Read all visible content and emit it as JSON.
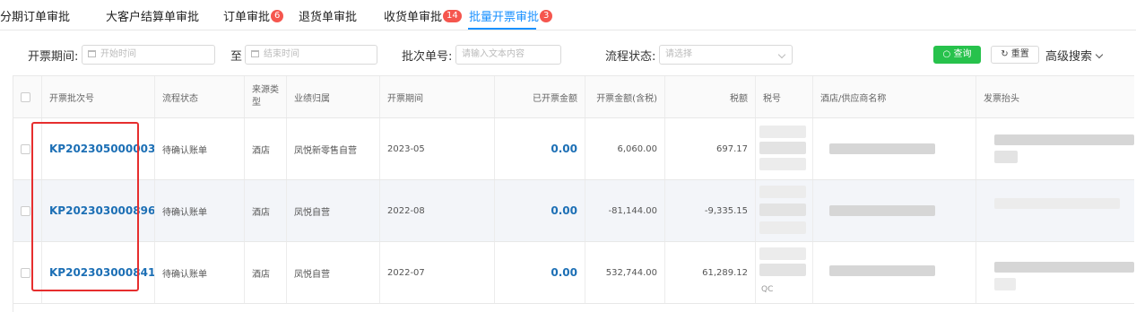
{
  "tabs": [
    {
      "label": "分期订单审批",
      "badge": ""
    },
    {
      "label": "大客户结算单审批",
      "badge": ""
    },
    {
      "label": "订单审批",
      "badge": "6"
    },
    {
      "label": "退货单审批",
      "badge": ""
    },
    {
      "label": "收货单审批",
      "badge": "14"
    },
    {
      "label": "批量开票审批",
      "badge": "3"
    }
  ],
  "active_tab": "批量开票审批",
  "filters": {
    "period_label": "开票期间:",
    "start_placeholder": "开始时间",
    "to_label": "至",
    "end_placeholder": "结束时间",
    "batch_label": "批次单号:",
    "batch_placeholder": "请输入文本内容",
    "status_label": "流程状态:",
    "status_placeholder": "请选择",
    "query_button": "查询",
    "reset_button": "重置",
    "advanced_search": "高级搜索"
  },
  "table": {
    "headers": {
      "batch_no": "开票批次号",
      "status": "流程状态",
      "source_type": "来源类型",
      "business": "业绩归属",
      "period": "开票期间",
      "invoiced_amount": "已开票金额",
      "invoice_amount_tax": "开票金额(含税)",
      "tax": "税额",
      "tax_no": "税号",
      "hotel_supplier": "酒店/供应商名称",
      "invoice_title": "发票抬头"
    },
    "rows": [
      {
        "batch_no": "KP202305000003",
        "status": "待确认账单",
        "source_type": "酒店",
        "business": "凤悦新零售自营",
        "period": "2023-05",
        "invoiced_amount": "0.00",
        "invoice_amount_tax": "6,060.00",
        "tax": "697.17"
      },
      {
        "batch_no": "KP202303000896",
        "status": "待确认账单",
        "source_type": "酒店",
        "business": "凤悦自营",
        "period": "2022-08",
        "invoiced_amount": "0.00",
        "invoice_amount_tax": "-81,144.00",
        "tax": "-9,335.15"
      },
      {
        "batch_no": "KP202303000841",
        "status": "待确认账单",
        "source_type": "酒店",
        "business": "凤悦自营",
        "period": "2022-07",
        "invoiced_amount": "0.00",
        "invoice_amount_tax": "532,744.00",
        "tax": "61,289.12"
      }
    ],
    "tax_no_partial": "QC"
  },
  "colors": {
    "accent": "#1890ff",
    "badge": "#f5564e",
    "query_button": "#27c24c",
    "highlight_box": "#e62e2e",
    "link": "#1c6fb5"
  }
}
